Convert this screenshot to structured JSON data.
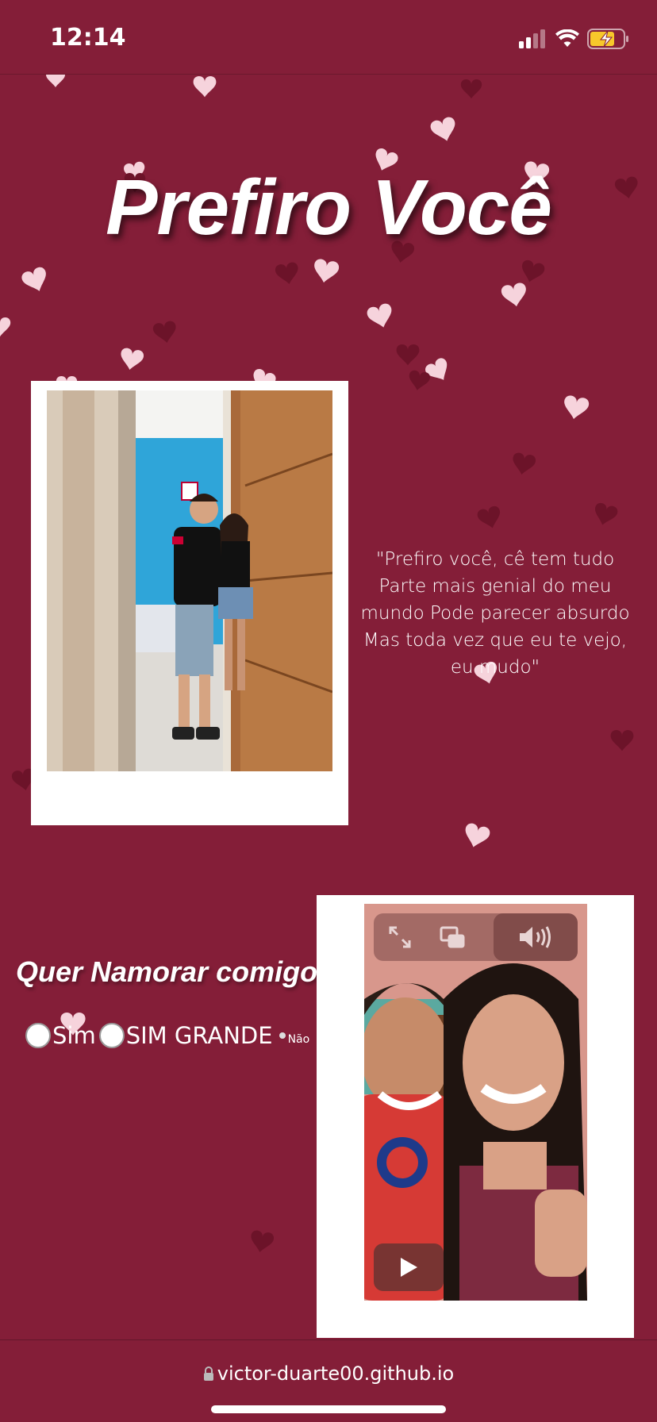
{
  "status_bar": {
    "time": "12:14"
  },
  "page": {
    "title": "Prefiro Você",
    "quote": "\"Prefiro você, cê tem tudo Parte mais genial do meu mundo Pode parecer absurdo Mas toda vez que eu te vejo, eu mudo\"",
    "question": "Quer Namorar comigo?",
    "options": [
      {
        "label": "Sim"
      },
      {
        "label": "SIM GRANDE"
      },
      {
        "label": "Não"
      }
    ]
  },
  "video": {
    "controls": [
      "fullscreen-icon",
      "picture-in-picture-icon",
      "volume-icon",
      "play-icon"
    ]
  },
  "browser": {
    "url": "victor-duarte00.github.io"
  },
  "colors": {
    "background": "#841e38",
    "heart_light": "#f6d3dc",
    "heart_dark": "#6c1329"
  }
}
